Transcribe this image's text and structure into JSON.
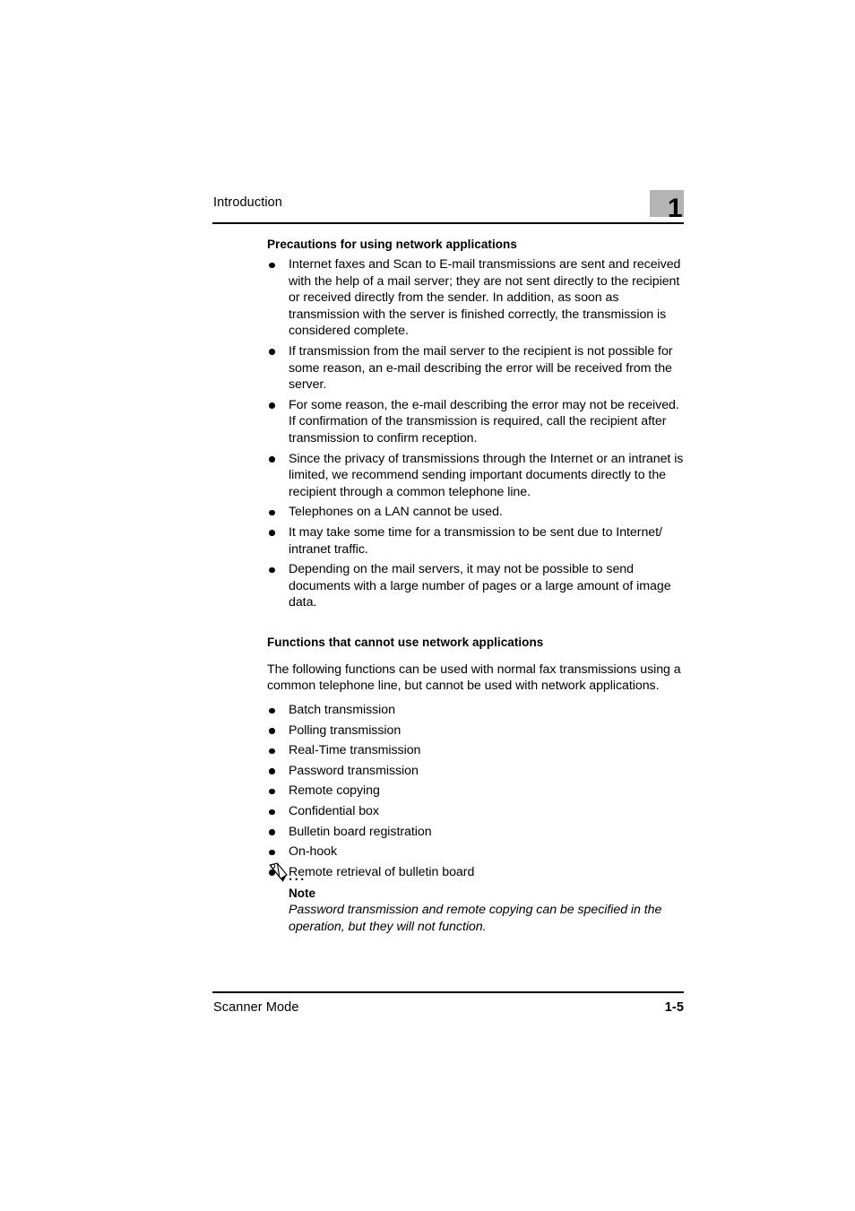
{
  "header": {
    "title": "Introduction",
    "chapter_number": "1",
    "badge_color": "#b4b4b4"
  },
  "sections": [
    {
      "heading": "Precautions for using network applications",
      "bullets": [
        "Internet faxes and Scan to E-mail transmissions are sent and received with the help of a mail server; they are not sent directly to the recipient or received directly from the sender. In addition, as soon as transmission with the server is finished correctly, the transmission is considered complete.",
        "If transmission from the mail server to the recipient is not possible for some reason, an e-mail describing the error will be received from the server.",
        "For some reason, the e-mail describing the error may not be received. If confirmation of the transmission is required, call the recipient after transmission to confirm reception.",
        "Since the privacy of transmissions through the Internet or an intranet is limited, we recommend sending important documents directly to the recipient through a common telephone line.",
        "Telephones on a LAN cannot be used.",
        "It may take some time for a transmission to be sent due to Internet/ intranet traffic.",
        "Depending on the mail servers, it may not be possible to send documents with a large number of pages or a large amount of image data."
      ]
    },
    {
      "heading": "Functions that cannot use network applications",
      "intro": "The following functions can be used with normal fax transmissions using a common telephone line, but cannot be used with network applications.",
      "bullets": [
        "Batch transmission",
        "Polling transmission",
        "Real-Time transmission",
        "Password transmission",
        "Remote copying",
        "Confidential box",
        "Bulletin board registration",
        "On-hook",
        "Remote retrieval of bulletin board"
      ]
    }
  ],
  "note": {
    "icon": "pencil-icon",
    "dots": "...",
    "label": "Note",
    "text": "Password transmission and remote copying can be specified in the operation, but they will not function."
  },
  "footer": {
    "left": "Scanner Mode",
    "page_number": "1-5"
  }
}
